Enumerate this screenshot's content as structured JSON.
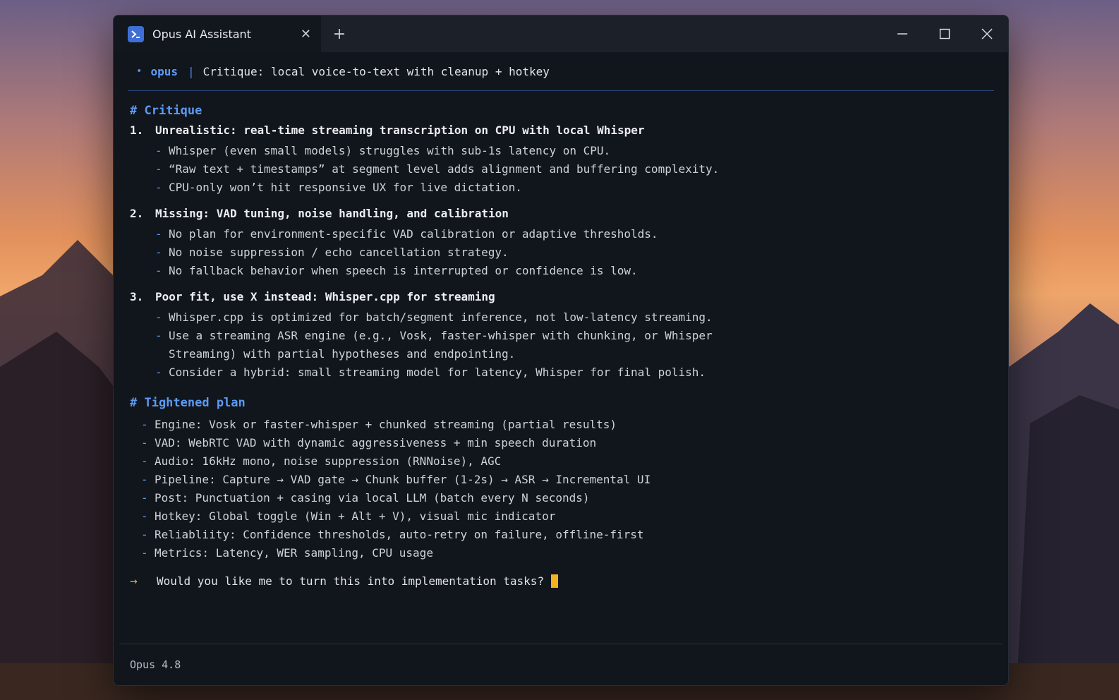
{
  "window": {
    "tab_title": "Opus AI Assistant",
    "tab_close": "✕",
    "new_tab": "+"
  },
  "header": {
    "dot": "•",
    "brand": "opus",
    "separator": "|",
    "session_title": "Critique: local voice-to-text with cleanup + hotkey"
  },
  "critique": {
    "heading": "# Critique",
    "items": [
      {
        "num": "1.",
        "title": "Unrealistic: real-time streaming transcription on CPU with local Whisper",
        "bullets": [
          "Whisper (even small models) struggles with sub-1s latency on CPU.",
          "“Raw text + timestamps” at segment level adds alignment and buffering complexity.",
          "CPU-only won’t hit responsive UX for live dictation."
        ]
      },
      {
        "num": "2.",
        "title": "Missing: VAD tuning, noise handling, and calibration",
        "bullets": [
          "No plan for environment-specific VAD calibration or adaptive thresholds.",
          "No noise suppression / echo cancellation strategy.",
          "No fallback behavior when speech is interrupted or confidence is low."
        ]
      },
      {
        "num": "3.",
        "title": "Poor fit, use X instead: Whisper.cpp for streaming",
        "bullets": [
          "Whisper.cpp is optimized for batch/segment inference, not low-latency streaming.",
          "Use a streaming ASR engine (e.g., Vosk, faster-whisper with chunking, or Whisper Streaming) with partial hypotheses and endpointing.",
          "Consider a hybrid: small streaming model for latency, Whisper for final polish."
        ]
      }
    ]
  },
  "plan": {
    "heading": "# Tightened plan",
    "items": [
      "Engine: Vosk or faster-whisper + chunked streaming (partial results)",
      "VAD: WebRTC VAD with dynamic aggressiveness + min speech duration",
      "Audio: 16kHz mono, noise suppression (RNNoise), AGC",
      "Pipeline: Capture → VAD gate → Chunk buffer (1-2s) → ASR → Incremental UI",
      "Post: Punctuation + casing via local LLM (batch every N seconds)",
      "Hotkey: Global toggle (Win + Alt + V), visual mic indicator",
      "Reliabliity: Confidence thresholds, auto-retry on failure, offline-first",
      "Metrics: Latency, WER sampling, CPU usage"
    ]
  },
  "prompt": {
    "arrow": "→",
    "text": "Would you like me to turn this into implementation tasks?"
  },
  "footer": {
    "model": "Opus 4.8"
  },
  "colors": {
    "accent": "#5b9bf5",
    "cursor": "#f2b41c",
    "window_bg": "#11151c"
  }
}
